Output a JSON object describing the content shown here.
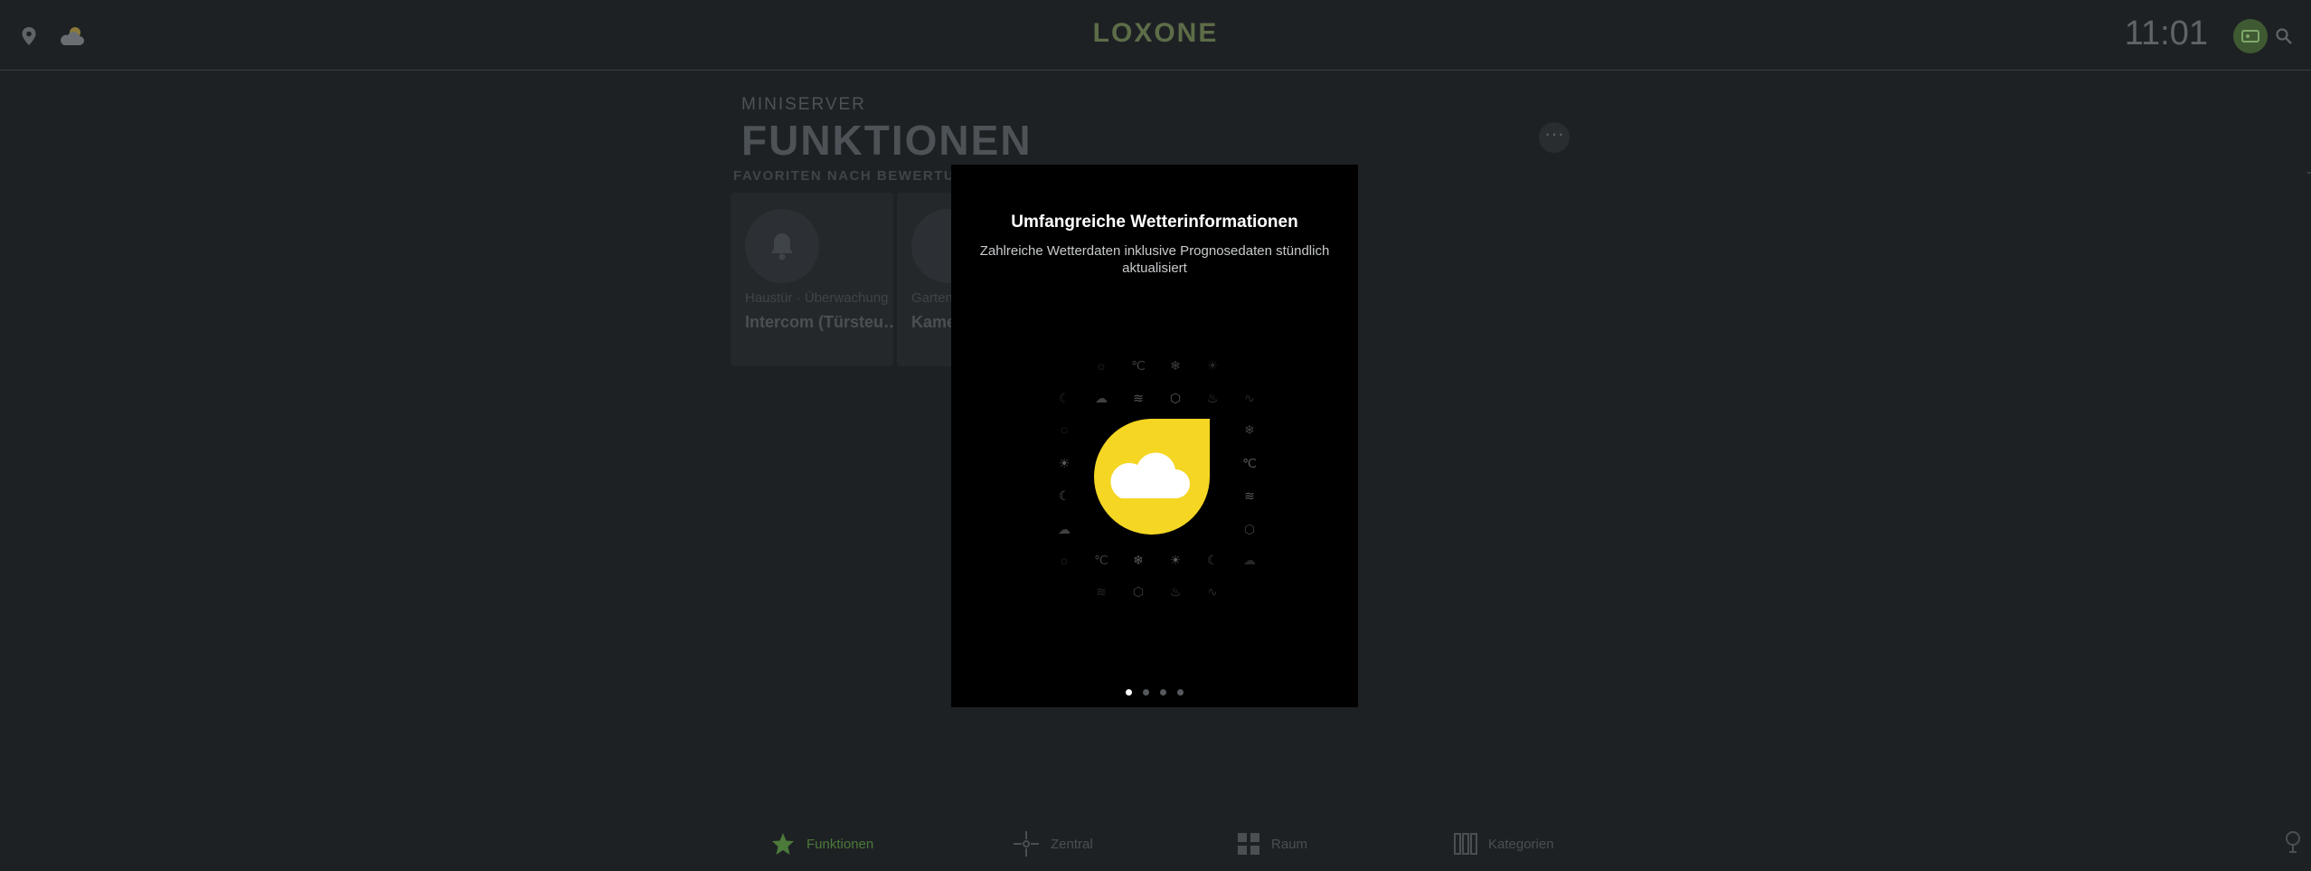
{
  "header": {
    "logo": "LOXONE",
    "clock": "11:01"
  },
  "page": {
    "section_label": "MINISERVER",
    "title": "FUNKTIONEN",
    "favorites_label": "FAVORITEN NACH BEWERTUNG",
    "more_label": "···"
  },
  "cards": [
    {
      "subtitle": "Haustür · Überwachung",
      "name": "Intercom (Türsteu…"
    },
    {
      "subtitle": "Garten",
      "name": "Kame"
    }
  ],
  "modal": {
    "title": "Umfangreiche Wetterinformationen",
    "description": "Zahlreiche Wetterdaten inklusive Prognosedaten stündlich aktualisiert",
    "page_count": 4,
    "active_page": 1,
    "accent_color": "#f4d623"
  },
  "bottom_nav": [
    {
      "label": "Funktionen",
      "icon": "star-icon",
      "active": true
    },
    {
      "label": "Zentral",
      "icon": "crosshair-icon",
      "active": false
    },
    {
      "label": "Raum",
      "icon": "grid-icon",
      "active": false
    },
    {
      "label": "Kategorien",
      "icon": "columns-icon",
      "active": false
    }
  ],
  "colors": {
    "background": "#1e2124",
    "active_green": "#4b7a3a",
    "modal_background": "#000000"
  }
}
